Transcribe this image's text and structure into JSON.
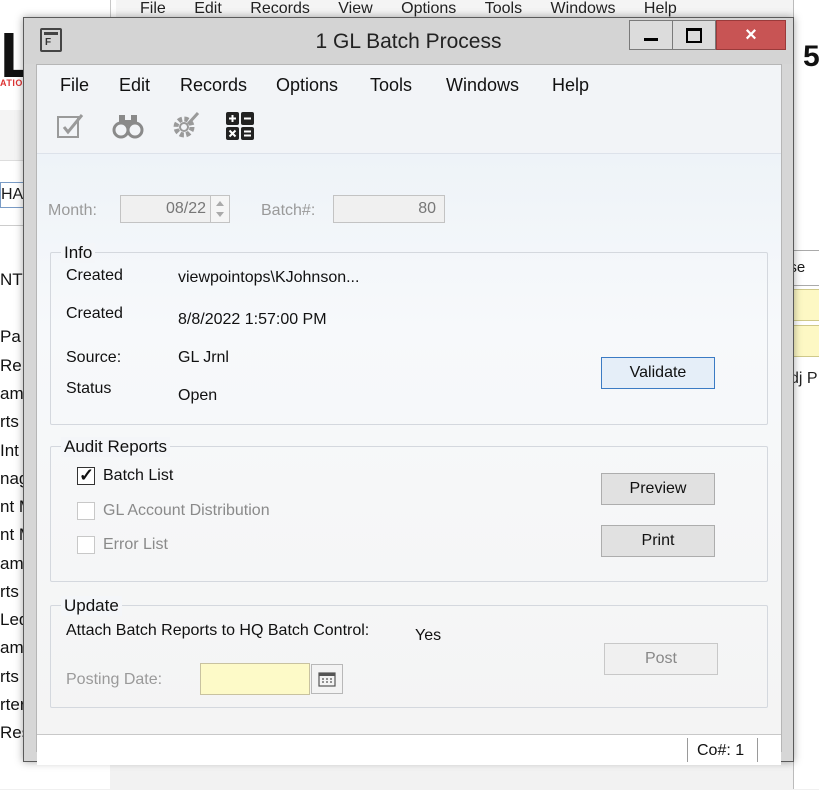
{
  "background": {
    "logo_text": "L",
    "logo_sub": "ATION",
    "left_input_value": "HA",
    "nav_items": [
      "NT",
      "Pa",
      "Re",
      "am",
      "rts",
      "Int",
      "nag",
      "nt M",
      "nt M",
      "am",
      "rts",
      "Led",
      "am",
      "rts",
      "rter",
      "Res"
    ],
    "top_menu_items": [
      "File",
      "Edit",
      "Records",
      "View",
      "Options",
      "Tools",
      "Windows",
      "Help"
    ],
    "right_digit": "5",
    "right_field1": "ose",
    "right_field2": ".",
    "right_text": "dj P"
  },
  "window": {
    "title": "1 GL Batch Process",
    "app_icon": "app-form-icon",
    "minimize_icon": "minimize-icon",
    "maximize_icon": "maximize-icon",
    "close_glyph": "×"
  },
  "menu": {
    "items": [
      "File",
      "Edit",
      "Records",
      "Options",
      "Tools",
      "Windows",
      "Help"
    ]
  },
  "toolbar": {
    "icons": [
      "edit-icon",
      "binoculars-icon",
      "gear-icon",
      "calculator-icon"
    ]
  },
  "header_fields": {
    "month_label": "Month:",
    "month_value": "08/22",
    "batch_label": "Batch#:",
    "batch_value": "80"
  },
  "info": {
    "title": "Info",
    "created_label": "Created",
    "created_by": "viewpointops\\KJohnson...",
    "created_date_label": "Created",
    "created_date": "8/8/2022 1:57:00 PM",
    "source_label": "Source:",
    "source_value": "GL Jrnl",
    "status_label": "Status",
    "status_value": "Open",
    "validate_label": "Validate"
  },
  "audit_reports": {
    "title": "Audit Reports",
    "items": [
      {
        "label": "Batch List",
        "checked": true,
        "enabled": true
      },
      {
        "label": "GL Account Distribution",
        "checked": false,
        "enabled": false
      },
      {
        "label": "Error List",
        "checked": false,
        "enabled": false
      }
    ],
    "preview_label": "Preview",
    "print_label": "Print"
  },
  "update": {
    "title": "Update",
    "attach_label": "Attach Batch Reports to HQ Batch Control:",
    "attach_value": "Yes",
    "posting_date_label": "Posting Date:",
    "posting_date_value": "",
    "post_label": "Post"
  },
  "statusbar": {
    "company": "Co#: 1"
  }
}
